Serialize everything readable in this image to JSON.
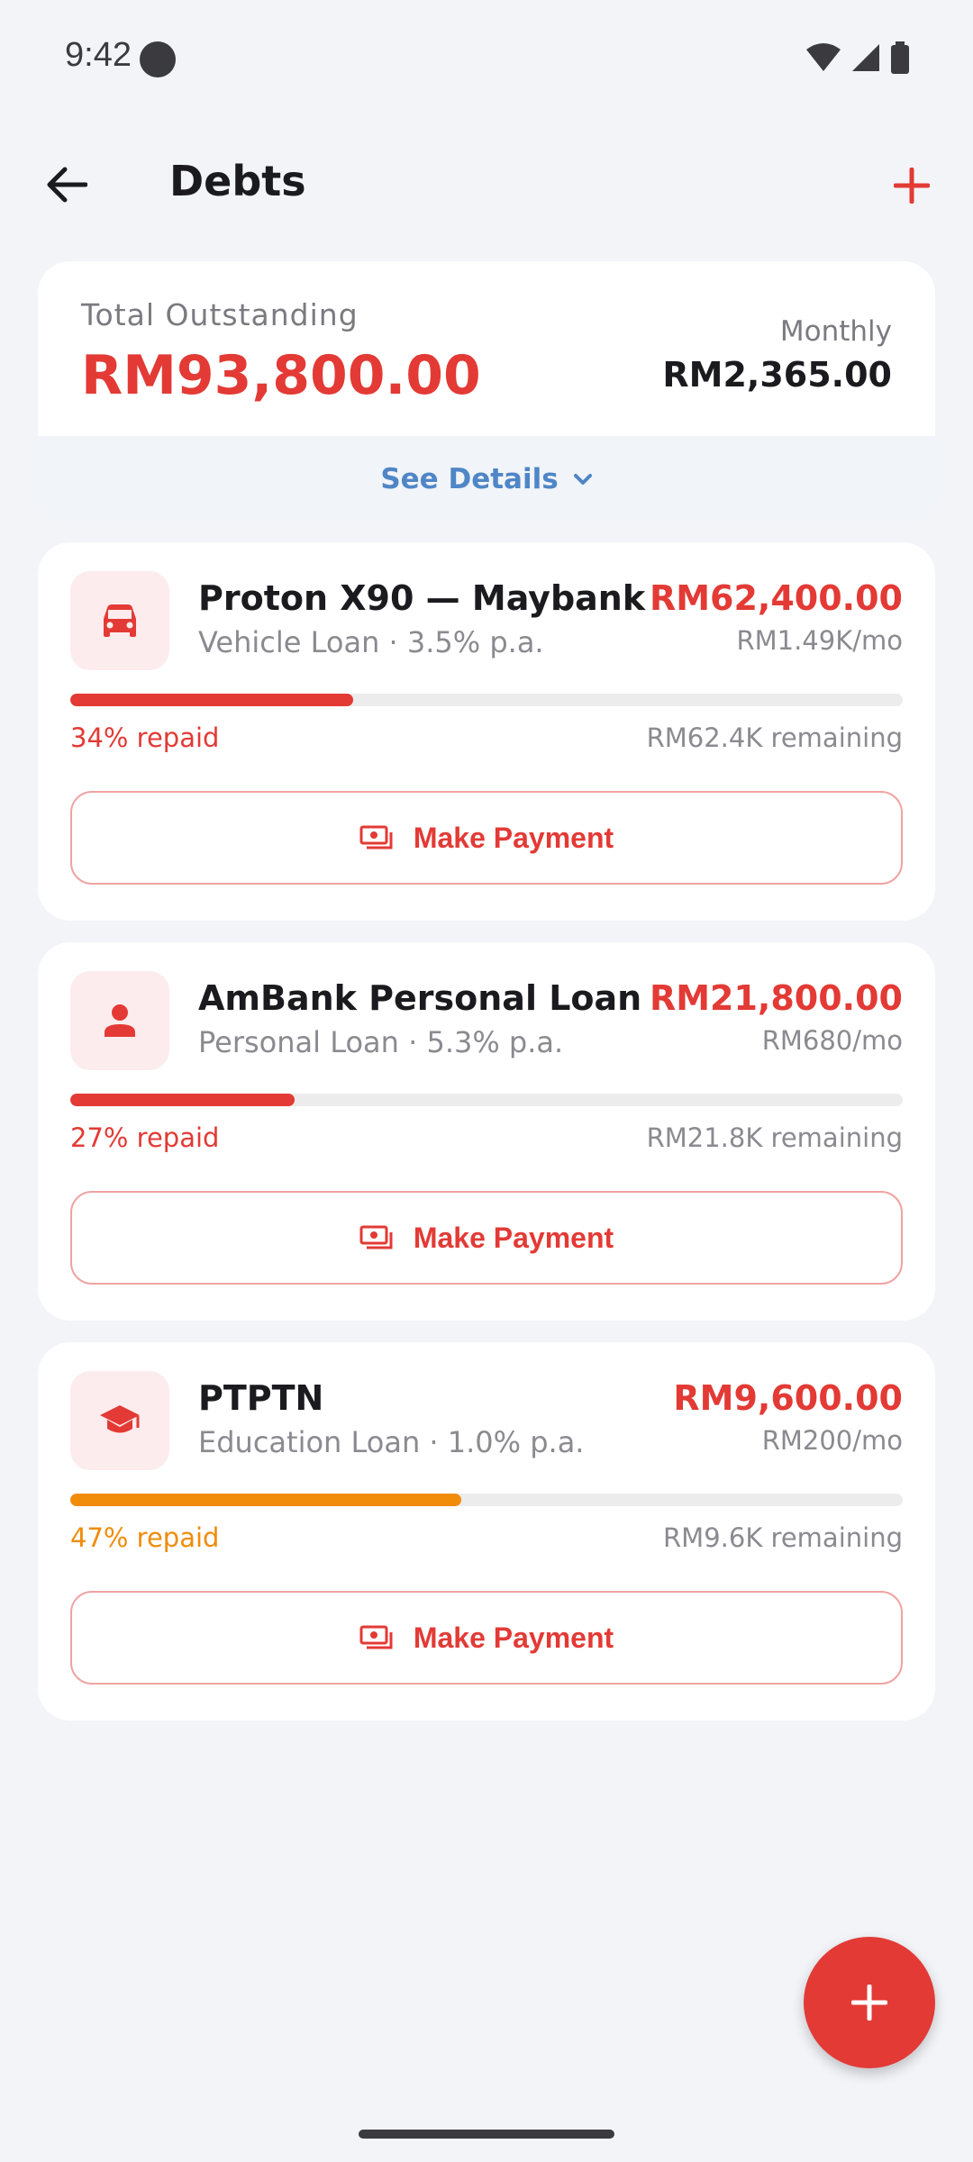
{
  "status_bar": {
    "time": "9:42"
  },
  "app_bar": {
    "title": "Debts"
  },
  "summary": {
    "total_label": "Total Outstanding",
    "total_value": "RM93,800.00",
    "monthly_label": "Monthly",
    "monthly_value": "RM2,365.00",
    "details_label": "See Details"
  },
  "debts": [
    {
      "name": "Proton X90 — Maybank",
      "subtitle": "Vehicle Loan · 3.5% p.a.",
      "amount": "RM62,400.00",
      "monthly": "RM1.49K/mo",
      "repaid_label": "34% repaid",
      "repaid_fraction": 0.34,
      "remaining": "RM62.4K remaining",
      "progress_color": "#e33a35",
      "icon": "car-icon",
      "action_label": "Make Payment"
    },
    {
      "name": "AmBank Personal Loan",
      "subtitle": "Personal Loan · 5.3% p.a.",
      "amount": "RM21,800.00",
      "monthly": "RM680/mo",
      "repaid_label": "27% repaid",
      "repaid_fraction": 0.27,
      "remaining": "RM21.8K remaining",
      "progress_color": "#e33a35",
      "icon": "person-icon",
      "action_label": "Make Payment"
    },
    {
      "name": "PTPTN",
      "subtitle": "Education Loan · 1.0% p.a.",
      "amount": "RM9,600.00",
      "monthly": "RM200/mo",
      "repaid_label": "47% repaid",
      "repaid_fraction": 0.47,
      "remaining": "RM9.6K remaining",
      "progress_color": "#f08c0a",
      "icon": "graduation-cap-icon",
      "action_label": "Make Payment"
    }
  ],
  "colors": {
    "accent": "#e33a35",
    "link": "#4f86c6",
    "warning": "#f08c0a"
  }
}
